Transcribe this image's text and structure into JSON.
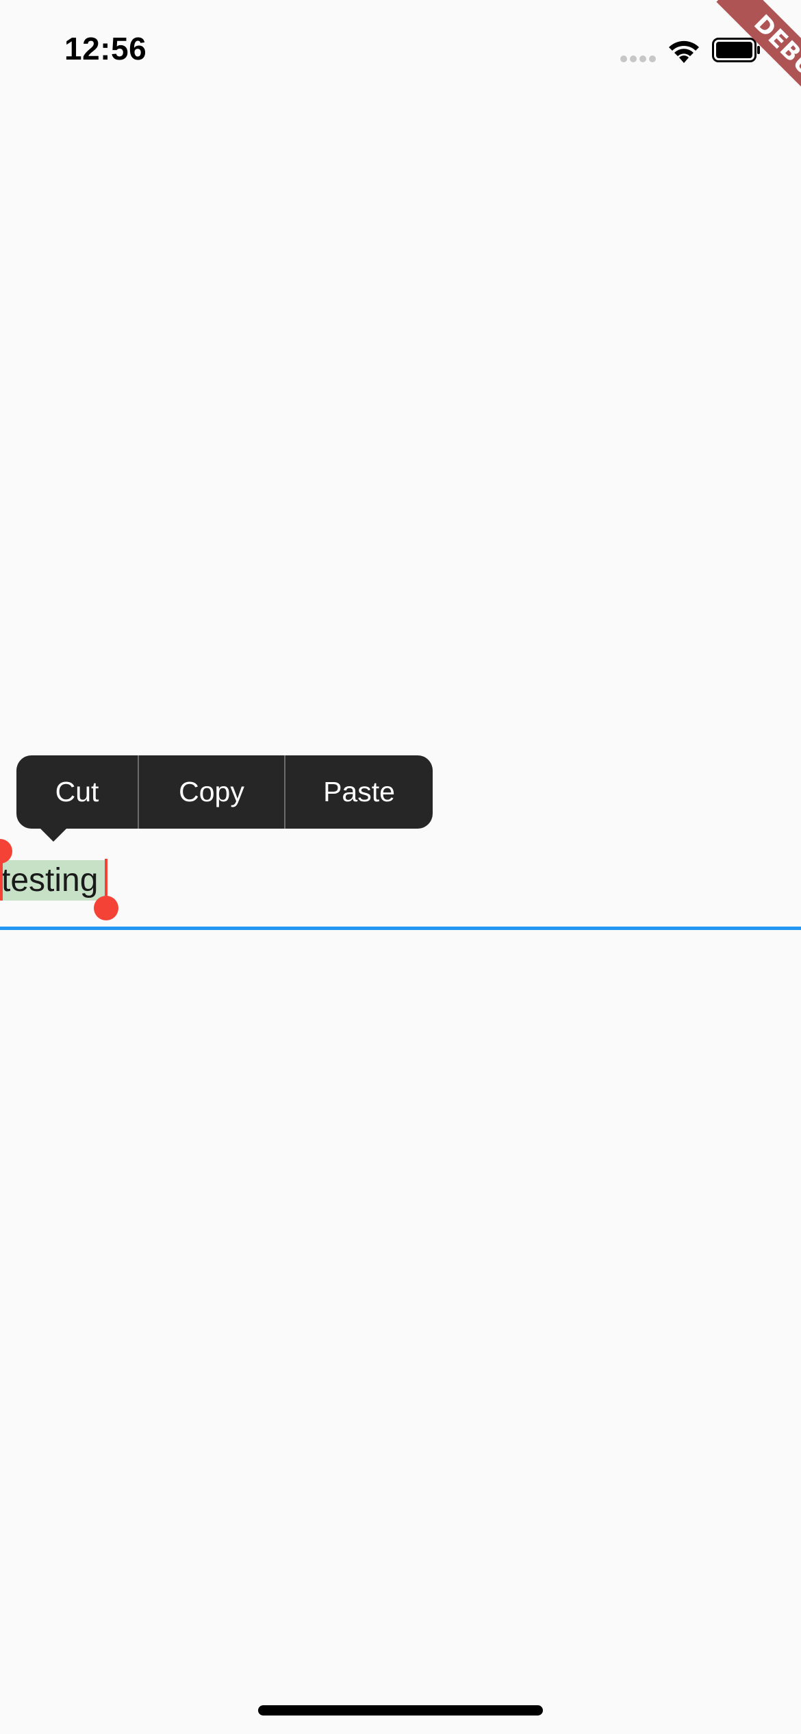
{
  "status_bar": {
    "time": "12:56"
  },
  "debug_banner": {
    "label": "DEBUG",
    "color": "#a33838"
  },
  "context_menu": {
    "items": [
      {
        "label": "Cut"
      },
      {
        "label": "Copy"
      },
      {
        "label": "Paste"
      }
    ],
    "background": "#262626"
  },
  "text_field": {
    "value": "testing",
    "underline_color": "#2196f3",
    "selection_color": "#c6e1c6",
    "handle_color": "#f44336"
  }
}
